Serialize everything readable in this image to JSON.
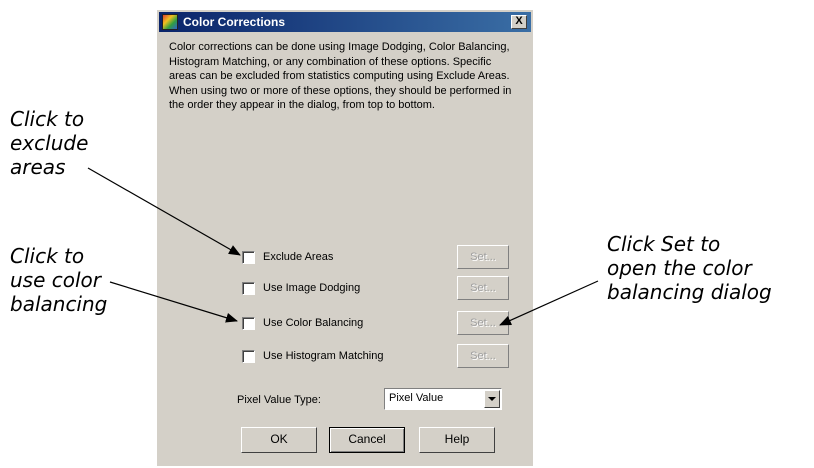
{
  "dialog": {
    "title": "Color Corrections",
    "close_label": "X",
    "description": "Color corrections can be done using Image Dodging, Color Balancing, Histogram Matching, or any combination of these options. Specific areas can be excluded from statistics computing using Exclude Areas. When using two or more of these options, they should be performed in the order they appear in the dialog, from top to bottom.",
    "options": [
      {
        "label": "Exclude Areas",
        "checked": false,
        "set_label": "Set..."
      },
      {
        "label": "Use Image Dodging",
        "checked": false,
        "set_label": "Set..."
      },
      {
        "label": "Use Color Balancing",
        "checked": false,
        "set_label": "Set..."
      },
      {
        "label": "Use Histogram Matching",
        "checked": false,
        "set_label": "Set..."
      }
    ],
    "pixel_value_type": {
      "label": "Pixel Value Type:",
      "value": "Pixel Value"
    },
    "buttons": {
      "ok": "OK",
      "cancel": "Cancel",
      "help": "Help"
    }
  },
  "callouts": {
    "exclude": [
      "Click to",
      "exclude",
      "areas"
    ],
    "balance": [
      "Click to",
      "use color",
      "balancing"
    ],
    "set": [
      "Click Set to",
      "open the color",
      "balancing dialog"
    ]
  }
}
